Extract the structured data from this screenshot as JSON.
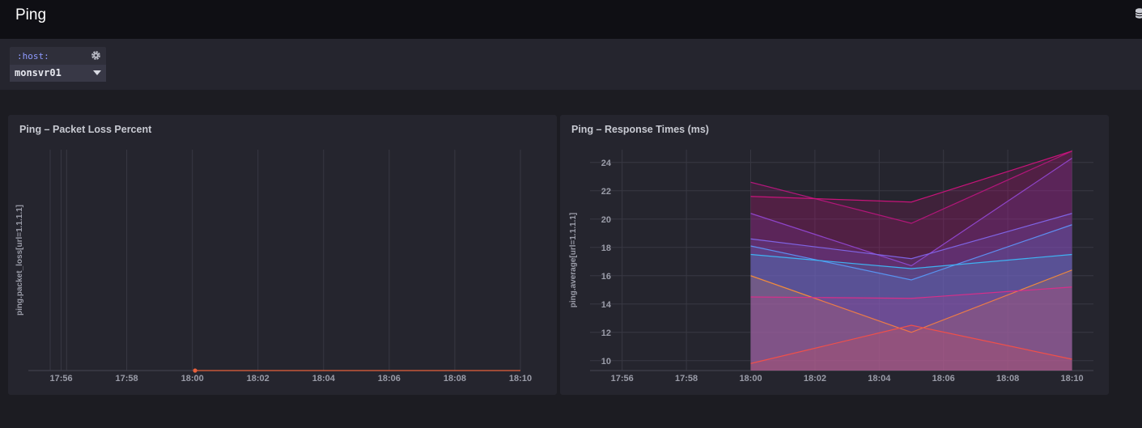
{
  "header": {
    "title": "Ping"
  },
  "variables": {
    "host": {
      "label": ":host:",
      "value": "monsvr01"
    }
  },
  "colors": {
    "accent": "#8f9bff",
    "background": "#1c1c22",
    "panel": "#25252e"
  },
  "chart_data": [
    {
      "type": "line",
      "title": "Ping – Packet Loss Percent",
      "xlabel": "",
      "ylabel": "ping.packet_loss[url=1.1.1.1]",
      "x_ticks": [
        "17:56",
        "17:58",
        "18:00",
        "18:02",
        "18:04",
        "18:06",
        "18:08",
        "18:10"
      ],
      "x_range": [
        "17:55:00",
        "18:10:00"
      ],
      "y_range": [
        0,
        1
      ],
      "grid": true,
      "series": [
        {
          "color": "#e8603c",
          "x": [
            "18:00:05",
            "18:10:00"
          ],
          "y": [
            0,
            0
          ]
        }
      ]
    },
    {
      "type": "area",
      "title": "Ping – Response Times (ms)",
      "xlabel": "",
      "ylabel": "ping.average[url=1.1.1.1]",
      "x_ticks": [
        "17:56",
        "17:58",
        "18:00",
        "18:02",
        "18:04",
        "18:06",
        "18:08",
        "18:10"
      ],
      "y_ticks": [
        "10",
        "12",
        "14",
        "16",
        "18",
        "20",
        "22",
        "24"
      ],
      "x_range": [
        "17:55:00",
        "18:10:40"
      ],
      "y_range": [
        9.3,
        24.9
      ],
      "grid": true,
      "series": [
        {
          "color": "#b0177a",
          "x": [
            "18:00",
            "18:05",
            "18:10"
          ],
          "y": [
            22.6,
            19.7,
            24.8
          ]
        },
        {
          "color": "#c8137a",
          "x": [
            "18:00",
            "18:05",
            "18:10"
          ],
          "y": [
            21.6,
            21.2,
            24.8
          ]
        },
        {
          "color": "#8e44c8",
          "x": [
            "18:00",
            "18:05",
            "18:10"
          ],
          "y": [
            20.4,
            16.7,
            24.3
          ]
        },
        {
          "color": "#7f63e3",
          "x": [
            "18:00",
            "18:05",
            "18:10"
          ],
          "y": [
            18.6,
            17.2,
            20.4
          ]
        },
        {
          "color": "#5e8df0",
          "x": [
            "18:00",
            "18:05",
            "18:10"
          ],
          "y": [
            18.1,
            15.7,
            19.6
          ]
        },
        {
          "color": "#3fb2f2",
          "x": [
            "18:00",
            "18:05",
            "18:10"
          ],
          "y": [
            17.5,
            16.5,
            17.5
          ]
        },
        {
          "color": "#f08a3c",
          "x": [
            "18:00",
            "18:05",
            "18:10"
          ],
          "y": [
            16.0,
            12.0,
            16.4
          ]
        },
        {
          "color": "#d62f8a",
          "x": [
            "18:00",
            "18:05",
            "18:10"
          ],
          "y": [
            14.5,
            14.4,
            15.2
          ]
        },
        {
          "color": "#f0504a",
          "x": [
            "18:00",
            "18:05",
            "18:10"
          ],
          "y": [
            9.8,
            12.5,
            10.1
          ]
        }
      ]
    }
  ]
}
